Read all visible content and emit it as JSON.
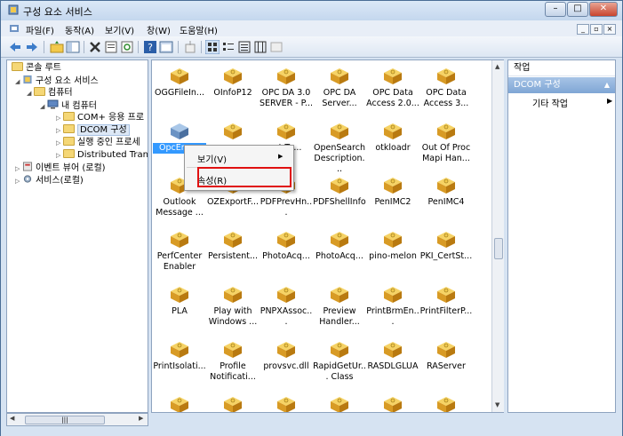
{
  "window": {
    "title": "구성 요소 서비스"
  },
  "menu": [
    "파일(F)",
    "동작(A)",
    "보기(V)",
    "창(W)",
    "도움말(H)"
  ],
  "tree": {
    "root": "콘솔 루트",
    "items": [
      {
        "label": "구성 요소 서비스",
        "level": 1
      },
      {
        "label": "컴퓨터",
        "level": 2
      },
      {
        "label": "내 컴퓨터",
        "level": 3
      },
      {
        "label": "COM+ 응용 프로",
        "level": 4
      },
      {
        "label": "DCOM 구성",
        "level": 4
      },
      {
        "label": "실행 중인 프로세",
        "level": 4
      },
      {
        "label": "Distributed Trans",
        "level": 4
      },
      {
        "label": "이벤트 뷰어 (로컬)",
        "level": 1
      },
      {
        "label": "서비스(로컬)",
        "level": 1
      }
    ],
    "selected": "DCOM 구성",
    "scroll_glyph": "|||"
  },
  "list": {
    "items": [
      "OGGFileIn...",
      "OInfoP12",
      "OPC DA 3.0 SERVER - P...",
      "OPC DA Server...",
      "OPC Data Access 2.0...",
      "OPC Data Access 3...",
      "OpcEnum",
      "",
      "...t.Te...",
      "OpenSearch Description...",
      "otkloadr",
      "Out Of Proc Mapi Han...",
      "Outlook Message ...",
      "OZExportF...",
      "PDFPrevHn...",
      "PDFShellInfo",
      "PenIMC2",
      "PenIMC4",
      "PerfCenter Enabler",
      "Persistent...",
      "PhotoAcq...",
      "PhotoAcq...",
      "pino-melon",
      "PKI_CertSt...",
      "PLA",
      "Play with Windows ...",
      "PNPXAssoc...",
      "Preview Handler...",
      "PrintBrmEn...",
      "PrintFilterP...",
      "PrintIsolati...",
      "Profile Notificati...",
      "provsvc.dll",
      "RapidGetUr... Class",
      "RASDLGLUA",
      "RAServer"
    ],
    "selected": "OpcEnum"
  },
  "context_menu": {
    "items": [
      "보기(V)",
      "속성(R)"
    ],
    "highlighted": "속성(R)",
    "highlight_color": "#e01010"
  },
  "actions": {
    "header": "작업",
    "group": "DCOM 구성",
    "item": "기타 작업"
  },
  "colors": {
    "selection": "#3399ff",
    "action_group": "#7fa6d5"
  }
}
